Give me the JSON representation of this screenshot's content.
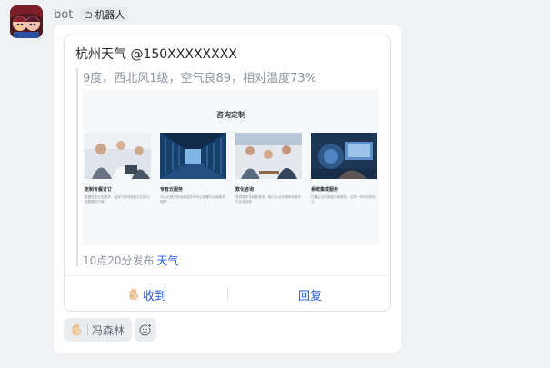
{
  "sender": {
    "name": "bot",
    "tag_label": "机器人"
  },
  "card": {
    "title": "杭州天气 @150XXXXXXXX",
    "summary": "9度，西北风1级，空气良89，相对温度73%",
    "poster": {
      "title": "咨询定制",
      "items": [
        {
          "title": "定制专属订订",
          "text": "根据您的业务需求，量身打造专属钉钉应用与流程解决方案"
        },
        {
          "title": "专有云服务",
          "text": "为企业提供安全稳定的专有云部署与运维服务保障"
        },
        {
          "title": "数化咨询",
          "text": "提供数字化转型咨询，助力企业实现降本增效与业务创新"
        },
        {
          "title": "系统集成服务",
          "text": "打通企业内部各系统数据，实现一体化协同办公"
        }
      ]
    },
    "meta_time": "10点20分发布",
    "meta_link": "天气",
    "actions": {
      "received_label": "收到",
      "reply_label": "回复"
    }
  },
  "reaction": {
    "user": "冯森林"
  },
  "colors": {
    "link": "#245bdb",
    "muted": "#8f959e",
    "page_bg": "#f0f1f3"
  },
  "icons": {
    "tag": "robot-icon",
    "received": "ok-hand-icon",
    "reaction": "ok-hand-icon",
    "add": "add-emoji-icon"
  }
}
